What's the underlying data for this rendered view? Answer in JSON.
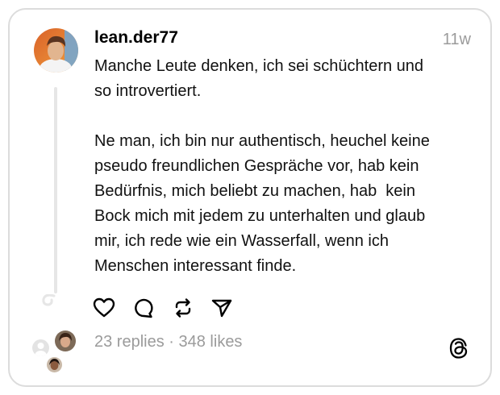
{
  "post": {
    "username": "lean.der77",
    "timestamp": "11w",
    "text": "Manche Leute denken, ich sei schüchtern und\nso introvertiert.\n\nNe man, ich bin nur authentisch, heuchel keine\npseudo freundlichen Gespräche vor, hab kein\nBedürfnis, mich beliebt zu machen, hab  kein\nBock mich mit jedem zu unterhalten und glaub\nmir, ich rede wie ein Wasserfall, wenn ich\nMenschen interessant finde.",
    "replies": "23 replies",
    "separator": " · ",
    "likes": "348 likes"
  },
  "icons": {
    "like": "heart-icon",
    "comment": "comment-icon",
    "repost": "repost-icon",
    "share": "send-icon",
    "brand": "threads-logo-icon"
  },
  "colors": {
    "muted_text": "#9b9b9b",
    "avatar_bg": "#e98a3a",
    "border": "#dcdcdc"
  }
}
